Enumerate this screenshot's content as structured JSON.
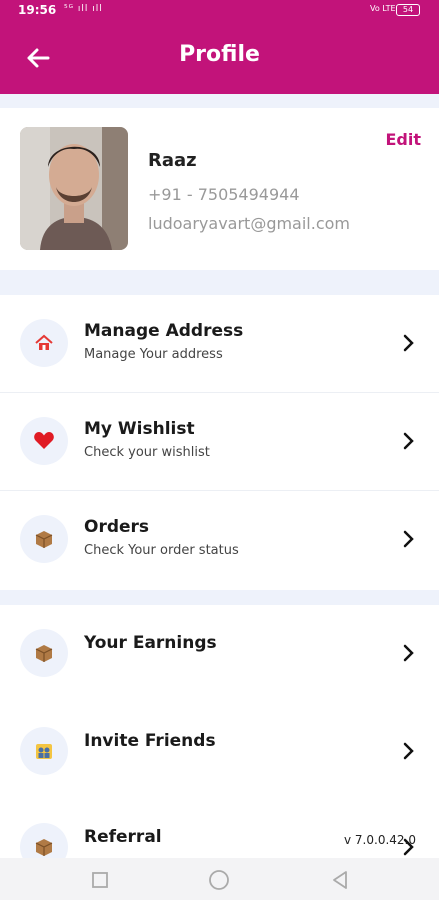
{
  "status_bar": {
    "time": "19:56",
    "signal_text": "⁵ᴳ ıll ıll",
    "volte": "Vo LTE",
    "battery": "54"
  },
  "header": {
    "title": "Profile",
    "back_icon": "arrow-left-icon"
  },
  "profile": {
    "name": "Raaz",
    "phone": "+91 - 7505494944",
    "email": "ludoaryavart@gmail.com",
    "edit_label": "Edit"
  },
  "menu_group_1": [
    {
      "title": "Manage Address",
      "subtitle": "Manage Your address",
      "icon": "home-icon"
    },
    {
      "title": "My Wishlist",
      "subtitle": "Check your wishlist",
      "icon": "heart-icon"
    },
    {
      "title": "Orders",
      "subtitle": "Check Your order status",
      "icon": "box-icon"
    }
  ],
  "menu_group_2": [
    {
      "title": "Your Earnings",
      "icon": "box-icon"
    },
    {
      "title": "Invite Friends",
      "icon": "people-icon"
    },
    {
      "title": "Referral",
      "icon": "box-icon"
    }
  ],
  "version": "v 7.0.0.42.0",
  "colors": {
    "accent": "#c2137a",
    "background": "#eef2fb",
    "card": "#ffffff"
  }
}
